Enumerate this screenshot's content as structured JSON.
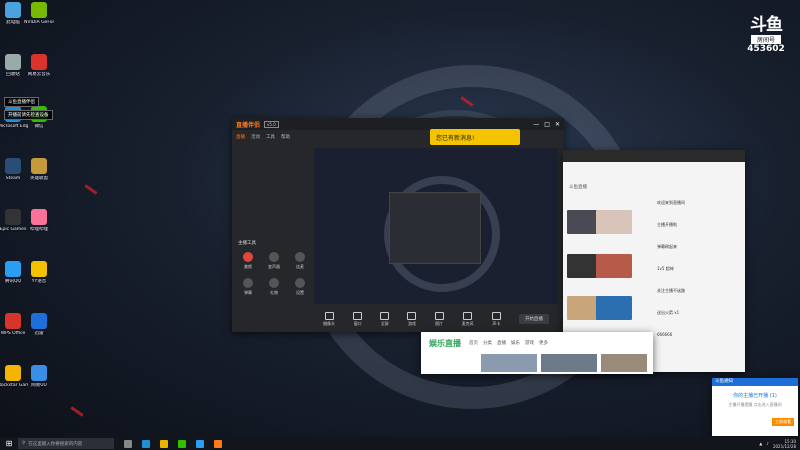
{
  "desktop": {
    "icons": [
      {
        "label": "此电脑",
        "color": "#4aa3df"
      },
      {
        "label": "回收站",
        "color": "#9aa"
      },
      {
        "label": "Microsoft Edge",
        "color": "#1f8fd8"
      },
      {
        "label": "Steam",
        "color": "#2a4d75"
      },
      {
        "label": "Epic Games",
        "color": "#333"
      },
      {
        "label": "腾讯QQ",
        "color": "#2b9ef3"
      },
      {
        "label": "WPS Office",
        "color": "#d9342b"
      },
      {
        "label": "Rockstar Games",
        "color": "#f4b400"
      },
      {
        "label": "NVIDIA GeForce",
        "color": "#76b900"
      },
      {
        "label": "网易云音乐",
        "color": "#d9342b"
      },
      {
        "label": "微信",
        "color": "#2dc100"
      },
      {
        "label": "英雄联盟",
        "color": "#c49a3a"
      },
      {
        "label": "哔哩哔哩",
        "color": "#fb7299"
      },
      {
        "label": "YY语音",
        "color": "#f2c200"
      },
      {
        "label": "迅雷",
        "color": "#1e6fd9"
      },
      {
        "label": "网易UU",
        "color": "#3a8ee6"
      }
    ],
    "tooltip_1": "斗鱼直播伴侣",
    "tooltip_2": "开播前请先检查设备"
  },
  "brand": {
    "logo": "斗鱼",
    "sub": "房间号",
    "room_id": "453602"
  },
  "stream_app": {
    "name": "直播伴侣",
    "version": "v5.0",
    "tabs": [
      "直播",
      "活动",
      "工具",
      "帮助"
    ],
    "side_title": "主播工具",
    "side_buttons": [
      "美颜",
      "变声器",
      "连麦",
      "弹幕",
      "礼物",
      "设置"
    ],
    "tools": [
      "摄像头",
      "窗口",
      "全屏",
      "游戏",
      "图片",
      "麦克风",
      "声卡",
      "更多"
    ],
    "start_label": "开始直播",
    "toast": "您已有新消息!"
  },
  "site": {
    "title": "斗鱼直播",
    "chat": [
      "欢迎来到直播间",
      "主播开播啦",
      "弹幕刷起来",
      "1v5 超神",
      "关注主播不迷路",
      "送出火箭 x1",
      "666666"
    ]
  },
  "video": {
    "logo": "娱乐直播",
    "nav": [
      "首页",
      "分类",
      "直播",
      "娱乐",
      "游戏",
      "更多"
    ]
  },
  "notification": {
    "header": "斗鱼通知",
    "title": "你的主播已开播 (1)",
    "body": "主播开播提醒 点击进入直播间",
    "ok": "立即观看"
  },
  "taskbar": {
    "search_placeholder": "在这里输入你要搜索的内容",
    "time": "15:30",
    "date": "2021/12/28"
  }
}
